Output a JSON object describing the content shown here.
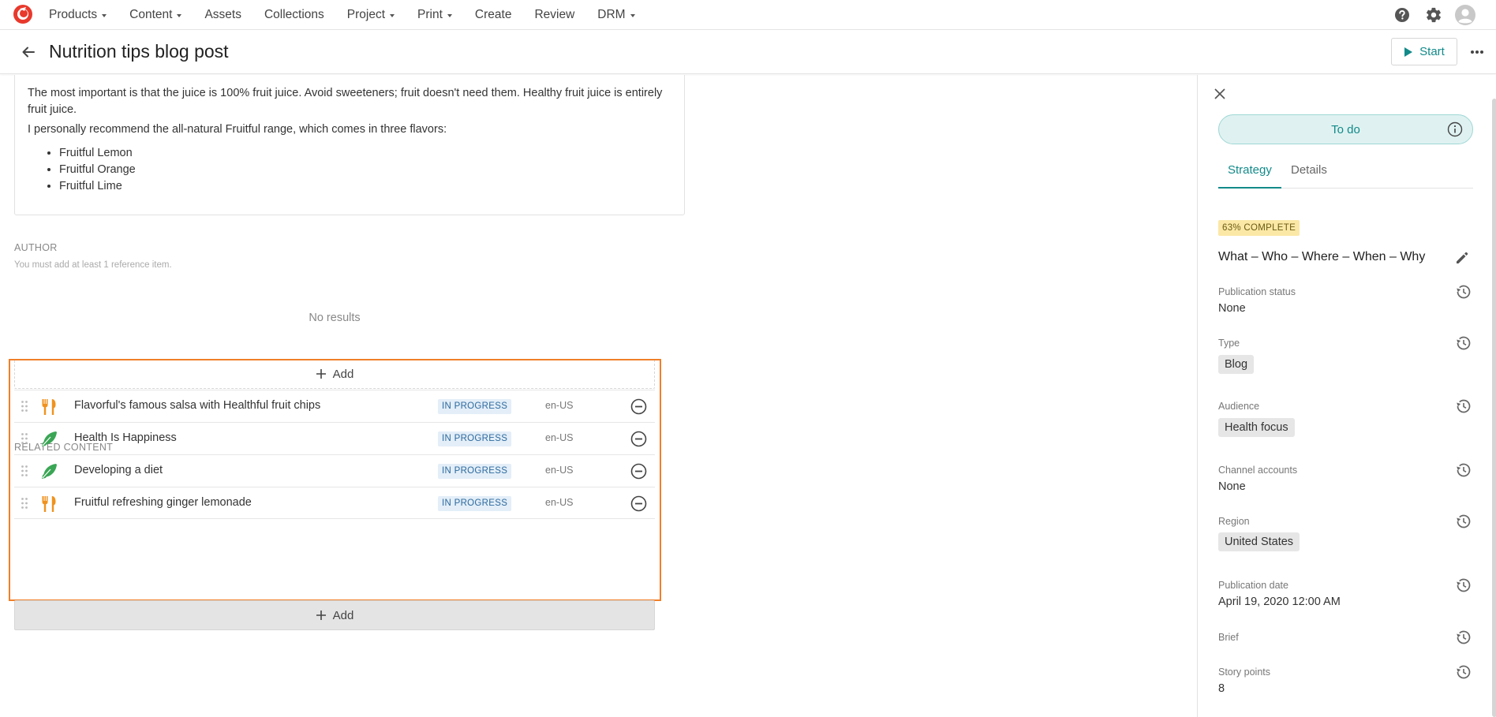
{
  "nav": {
    "items": [
      {
        "label": "Products",
        "caret": true
      },
      {
        "label": "Content",
        "caret": true
      },
      {
        "label": "Assets",
        "caret": false
      },
      {
        "label": "Collections",
        "caret": false
      },
      {
        "label": "Project",
        "caret": true
      },
      {
        "label": "Print",
        "caret": true
      },
      {
        "label": "Create",
        "caret": false
      },
      {
        "label": "Review",
        "caret": false
      },
      {
        "label": "DRM",
        "caret": true
      }
    ],
    "icons": [
      "help-icon",
      "gear-icon",
      "user-avatar-icon"
    ]
  },
  "header": {
    "title": "Nutrition tips blog post",
    "start_label": "Start"
  },
  "article": {
    "paragraph1": "The most important is that the juice is 100% fruit juice. Avoid sweeteners; fruit doesn't need them. Healthy fruit juice is entirely fruit juice.",
    "paragraph2": "I personally recommend the all-natural Fruitful range, which comes in three flavors:",
    "flavors": [
      "Fruitful Lemon",
      "Fruitful Orange",
      "Fruitful Lime"
    ]
  },
  "author": {
    "label": "AUTHOR",
    "hint": "You must add at least 1 reference item.",
    "empty": "No results",
    "add_label": "Add"
  },
  "related": {
    "label": "RELATED CONTENT",
    "add_label": "Add",
    "items": [
      {
        "title": "Flavorful's famous salsa with Healthful fruit chips",
        "status": "IN PROGRESS",
        "locale": "en-US",
        "icon": "recipe-icon"
      },
      {
        "title": "Health Is Happiness",
        "status": "IN PROGRESS",
        "locale": "en-US",
        "icon": "feather-icon"
      },
      {
        "title": "Developing a diet",
        "status": "IN PROGRESS",
        "locale": "en-US",
        "icon": "feather-icon"
      },
      {
        "title": "Fruitful refreshing ginger lemonade",
        "status": "IN PROGRESS",
        "locale": "en-US",
        "icon": "recipe-icon"
      }
    ]
  },
  "panel": {
    "status_button": "To do",
    "tabs": [
      "Strategy",
      "Details"
    ],
    "complete_badge": "63% COMPLETE",
    "strategy_title": "What – Who – Where – When – Why",
    "fields": [
      {
        "label": "Publication status",
        "value": "None",
        "chip": false
      },
      {
        "label": "Type",
        "value": "Blog",
        "chip": true
      },
      {
        "label": "Audience",
        "value": "Health focus",
        "chip": true
      },
      {
        "label": "Channel accounts",
        "value": "None",
        "chip": false
      },
      {
        "label": "Region",
        "value": "United States",
        "chip": true
      },
      {
        "label": "Publication date",
        "value": "April 19, 2020 12:00 AM",
        "chip": false
      },
      {
        "label": "Brief",
        "value": "",
        "chip": false
      },
      {
        "label": "Story points",
        "value": "8",
        "chip": false
      }
    ]
  },
  "colors": {
    "accent": "#138a8a",
    "highlight_frame": "#f07f28",
    "recipe_icon": "#f0921e",
    "feather_icon": "#3aa655",
    "logo": "#e8392c"
  }
}
